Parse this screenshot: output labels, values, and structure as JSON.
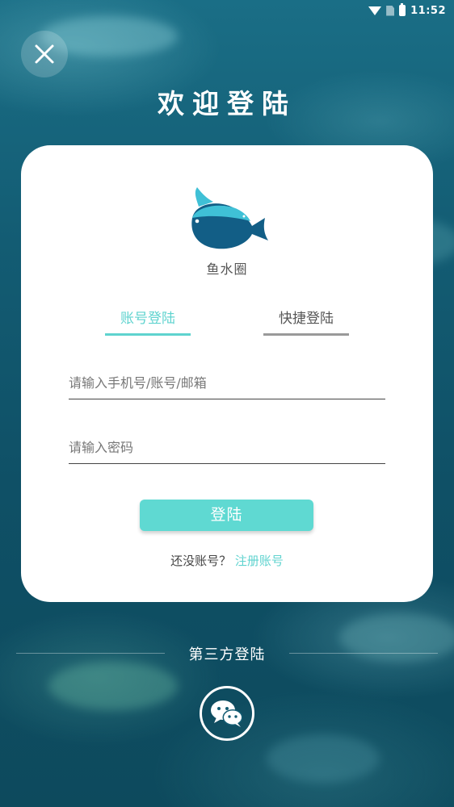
{
  "status_bar": {
    "time": "11:52"
  },
  "header": {
    "title": "欢迎登陆"
  },
  "card": {
    "app_name": "鱼水圈",
    "tabs": [
      {
        "label": "账号登陆",
        "active": true
      },
      {
        "label": "快捷登陆",
        "active": false
      }
    ],
    "username_field": {
      "placeholder": "请输入手机号/账号/邮箱",
      "value": ""
    },
    "password_field": {
      "placeholder": "请输入密码",
      "value": ""
    },
    "login_button": "登陆",
    "register_prompt": "还没账号？",
    "register_link": "注册账号"
  },
  "third_party": {
    "label": "第三方登陆",
    "providers": [
      "wechat-icon"
    ]
  },
  "colors": {
    "accent": "#5fd3cf",
    "button": "#5fd9d2",
    "logo": "#125e86"
  }
}
